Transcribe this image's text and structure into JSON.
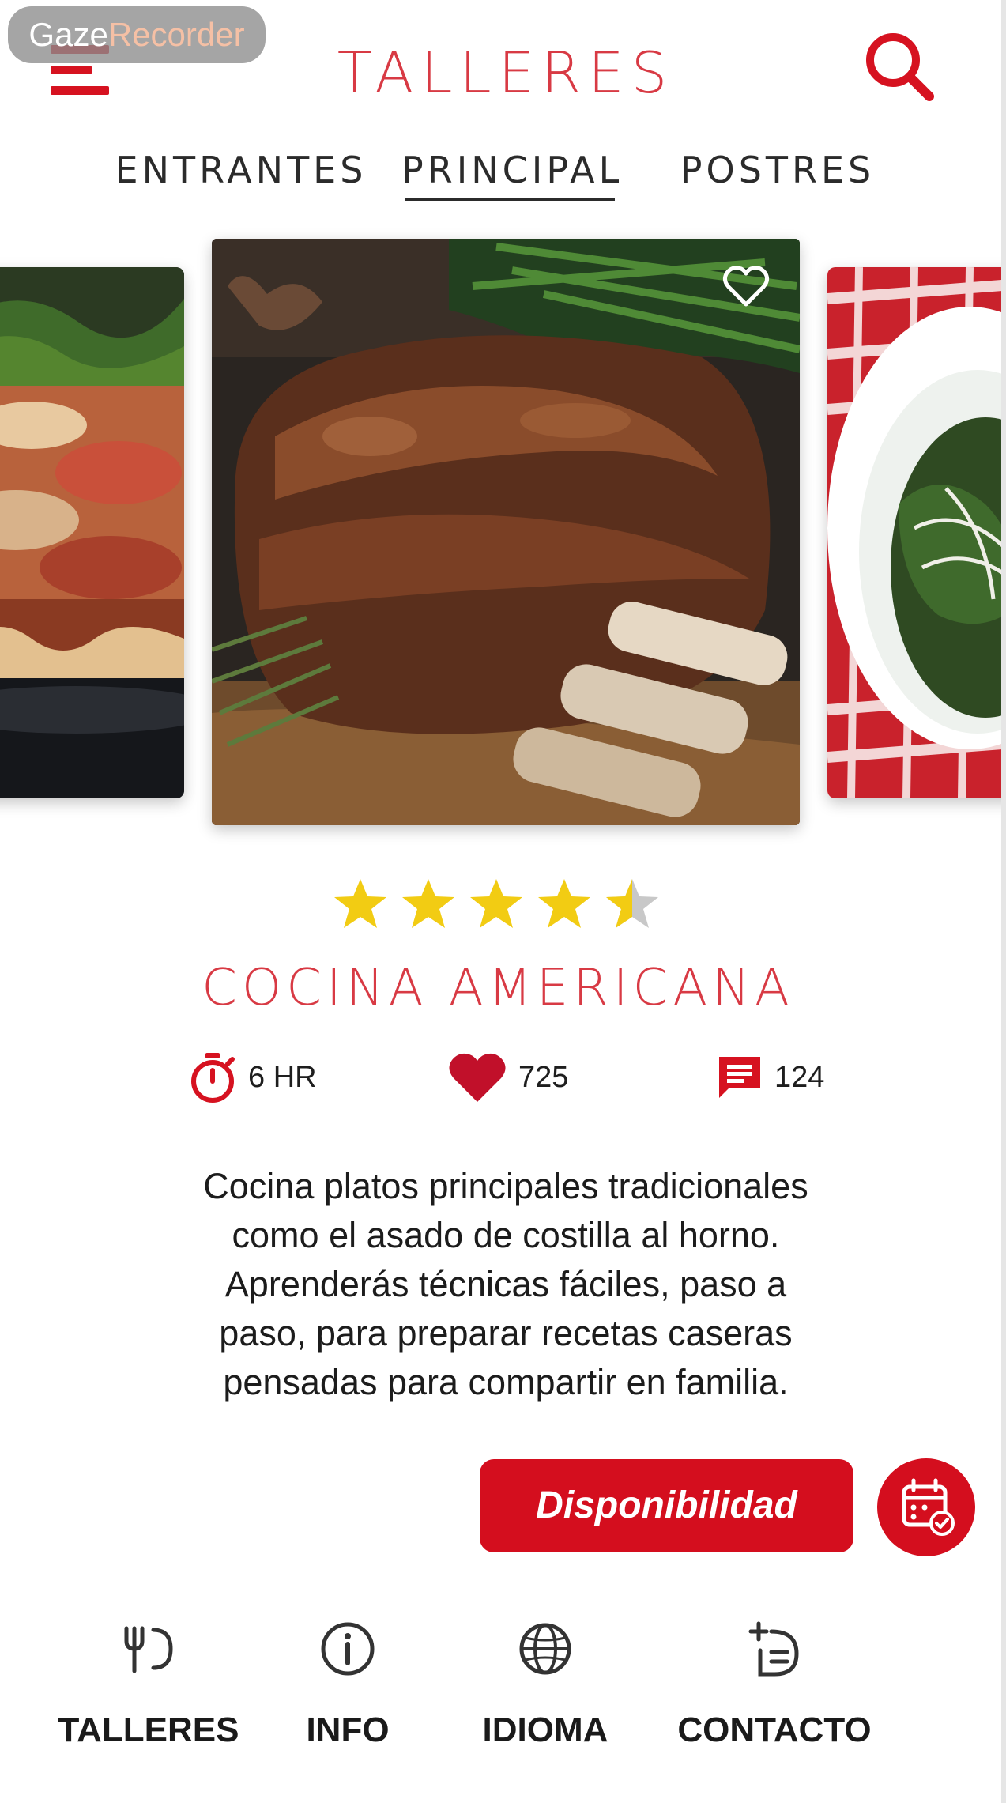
{
  "overlay": {
    "badge_part1": "Gaze",
    "badge_part2": "Recorder"
  },
  "header": {
    "brand": "TALLERES",
    "menu_icon": "hamburger-menu-icon",
    "search_icon": "search-icon"
  },
  "tabs": [
    {
      "label": "ENTRANTES",
      "active": false
    },
    {
      "label": "PRINCIPAL",
      "active": true
    },
    {
      "label": "POSTRES",
      "active": false
    }
  ],
  "carousel": {
    "cards": [
      "lasagna-image",
      "roast-ribs-image",
      "greens-bowl-image"
    ],
    "favorite_icon": "heart-outline-icon"
  },
  "workshop": {
    "rating": 4.5,
    "rating_max": 5,
    "title": "COCINA AMERICANA",
    "stats": {
      "time": "6 HR",
      "likes": "725",
      "comments": "124"
    },
    "description_lines": [
      "Cocina platos principales tradicionales",
      "como el asado de costilla al horno.",
      "Aprenderás técnicas fáciles, paso a",
      "paso, para preparar recetas caseras",
      "pensadas para compartir en familia."
    ]
  },
  "actions": {
    "availability_label": "Disponibilidad",
    "calendar_icon": "calendar-check-icon"
  },
  "bottom_nav": [
    {
      "label": "TALLERES",
      "icon": "fork-spoon-icon"
    },
    {
      "label": "INFO",
      "icon": "info-icon"
    },
    {
      "label": "IDIOMA",
      "icon": "globe-icon"
    },
    {
      "label": "CONTACTO",
      "icon": "add-list-icon"
    }
  ],
  "colors": {
    "brand_red": "#d61220",
    "title_red": "#d83a44",
    "star_gold": "#f2cc13",
    "star_grey": "#c8c8c8"
  }
}
